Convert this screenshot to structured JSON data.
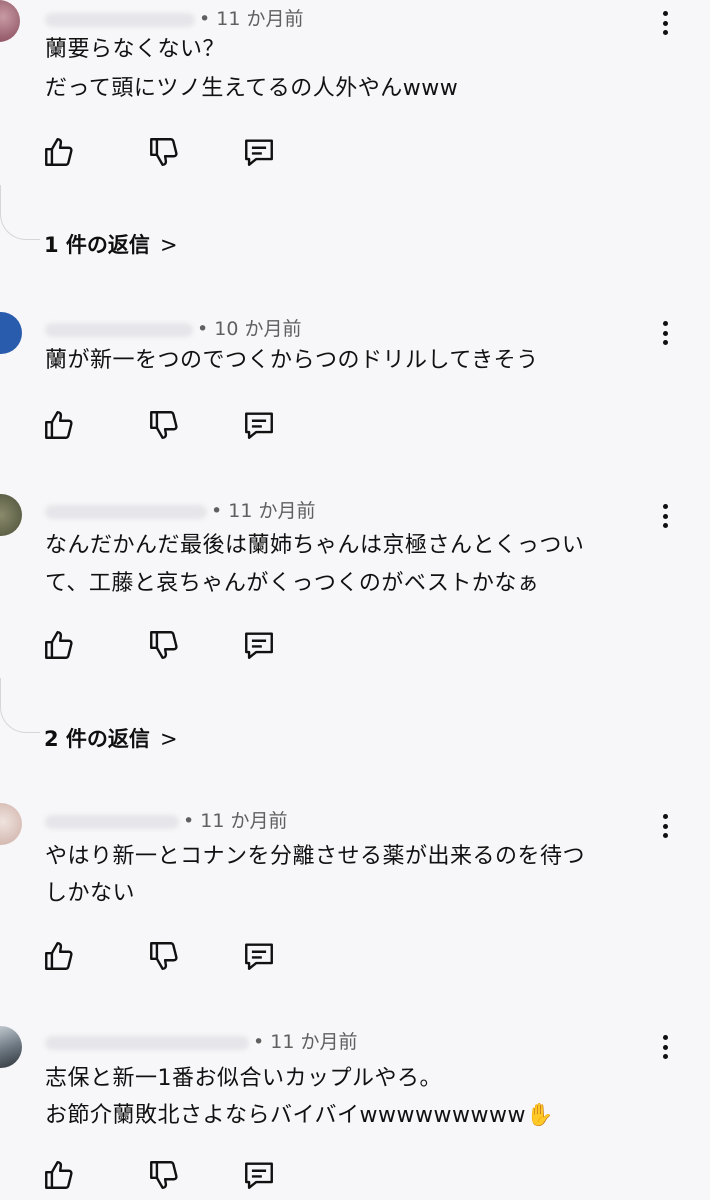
{
  "comments": [
    {
      "time": "• 11 か月前",
      "lines": [
        "蘭要らなくない？",
        "だって頭にツノ生えてるの人外やんwww"
      ],
      "replies": "1 件の返信"
    },
    {
      "time": "• 10 か月前",
      "lines": [
        "蘭が新一をつのでつくからつのドリルしてきそう"
      ]
    },
    {
      "time": "• 11 か月前",
      "lines": [
        "なんだかんだ最後は蘭姉ちゃんは京極さんとくっつい",
        "て、工藤と哀ちゃんがくっつくのがベストかなぁ"
      ],
      "replies": "2 件の返信"
    },
    {
      "time": "• 11 か月前",
      "lines": [
        "やはり新一とコナンを分離させる薬が出来るのを待つ",
        "しかない"
      ]
    },
    {
      "time": "• 11 か月前",
      "lines": [
        "志保と新一1番お似合いカップルやろ。",
        "お節介蘭敗北さよならバイバイwwwwwwwww✋"
      ]
    }
  ],
  "icons": {
    "like": "thumbs-up-icon",
    "dislike": "thumbs-down-icon",
    "reply": "reply-comment-icon",
    "menu": "more-vertical-icon",
    "chevron": "chevron-right-icon"
  },
  "colors": {
    "background": "#f7f7f9",
    "text": "#0f0f0f",
    "meta": "#606060"
  }
}
